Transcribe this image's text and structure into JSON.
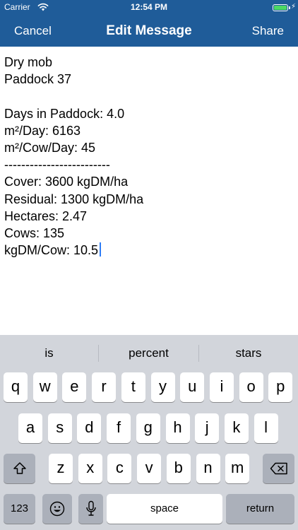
{
  "status_bar": {
    "carrier": "Carrier",
    "time": "12:54 PM",
    "battery_level": 1.0
  },
  "nav": {
    "cancel": "Cancel",
    "title": "Edit Message",
    "share": "Share"
  },
  "message": {
    "lines": [
      "Dry mob",
      "Paddock 37",
      "",
      "Days in Paddock: 4.0",
      "m²/Day: 6163",
      "m²/Cow/Day: 45",
      "-------------------------",
      "Cover: 3600 kgDM/ha",
      "Residual: 1300 kgDM/ha",
      "Hectares: 2.47",
      "Cows: 135",
      "kgDM/Cow: 10.5"
    ]
  },
  "keyboard": {
    "suggestions": [
      "is",
      "percent",
      "stars"
    ],
    "rows": [
      [
        "q",
        "w",
        "e",
        "r",
        "t",
        "y",
        "u",
        "i",
        "o",
        "p"
      ],
      [
        "a",
        "s",
        "d",
        "f",
        "g",
        "h",
        "j",
        "k",
        "l"
      ],
      [
        "z",
        "x",
        "c",
        "v",
        "b",
        "n",
        "m"
      ]
    ],
    "numbers_label": "123",
    "space_label": "space",
    "return_label": "return",
    "icons": {
      "shift": "shift-icon",
      "delete": "delete-icon",
      "emoji": "emoji-icon",
      "mic": "microphone-icon",
      "wifi": "wifi-icon",
      "battery": "battery-icon"
    }
  },
  "colors": {
    "nav_background": "#1F5C99",
    "keyboard_background": "#D2D5DB",
    "dark_key": "#ABB0BA",
    "caret": "#2D7CF6",
    "battery_fill": "#4CD964"
  }
}
